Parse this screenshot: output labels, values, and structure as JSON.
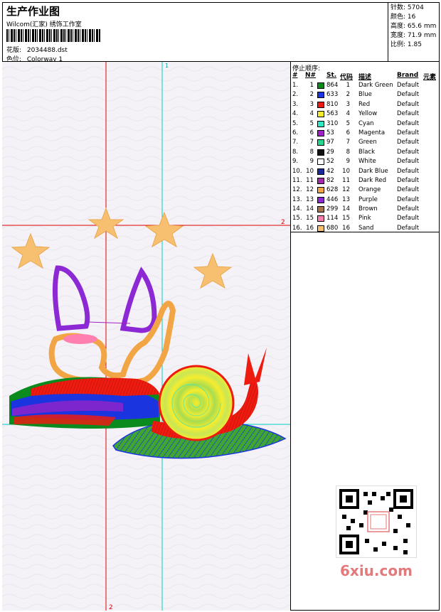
{
  "header": {
    "title": "生产作业图",
    "studio": "Wilcom(汇家) 绣饰工作室",
    "design_label": "花版:",
    "design_value": "2034488.dst",
    "colorway_label": "色位:",
    "colorway_value": "Colorway 1"
  },
  "stats": {
    "stitches_label": "针数:",
    "stitches_value": "5704",
    "colors_label": "颜色:",
    "colors_value": "16",
    "height_label": "高度:",
    "height_value": "65.6 mm",
    "width_label": "宽度:",
    "width_value": "71.9 mm",
    "ratio_label": "比例:",
    "ratio_value": "1.85"
  },
  "stop_sequence": {
    "title": "停止顺序:",
    "headers": {
      "idx": "#",
      "num": "N#",
      "st": "St.",
      "code": "代码",
      "desc": "描述",
      "brand": "Brand",
      "element": "元素"
    },
    "rows": [
      {
        "idx": "1.",
        "num": "1",
        "color": "#0b8a1e",
        "st": "864",
        "code": "1",
        "desc": "Dark Green",
        "brand": "Default"
      },
      {
        "idx": "2.",
        "num": "2",
        "color": "#1a35e0",
        "st": "633",
        "code": "2",
        "desc": "Blue",
        "brand": "Default"
      },
      {
        "idx": "3.",
        "num": "3",
        "color": "#ee1b10",
        "st": "810",
        "code": "3",
        "desc": "Red",
        "brand": "Default"
      },
      {
        "idx": "4.",
        "num": "4",
        "color": "#f6ec2e",
        "st": "563",
        "code": "4",
        "desc": "Yellow",
        "brand": "Default"
      },
      {
        "idx": "5.",
        "num": "5",
        "color": "#2fe8c6",
        "st": "310",
        "code": "5",
        "desc": "Cyan",
        "brand": "Default"
      },
      {
        "idx": "6.",
        "num": "6",
        "color": "#a021c7",
        "st": "53",
        "code": "6",
        "desc": "Magenta",
        "brand": "Default"
      },
      {
        "idx": "7.",
        "num": "7",
        "color": "#22d890",
        "st": "97",
        "code": "7",
        "desc": "Green",
        "brand": "Default"
      },
      {
        "idx": "8.",
        "num": "8",
        "color": "#111111",
        "st": "29",
        "code": "8",
        "desc": "Black",
        "brand": "Default"
      },
      {
        "idx": "9.",
        "num": "9",
        "color": "#ffffff",
        "st": "52",
        "code": "9",
        "desc": "White",
        "brand": "Default"
      },
      {
        "idx": "10.",
        "num": "10",
        "color": "#1b2a99",
        "st": "42",
        "code": "10",
        "desc": "Dark Blue",
        "brand": "Default"
      },
      {
        "idx": "11.",
        "num": "11",
        "color": "#a12aa8",
        "st": "82",
        "code": "11",
        "desc": "Dark Red",
        "brand": "Default"
      },
      {
        "idx": "12.",
        "num": "12",
        "color": "#f2a545",
        "st": "628",
        "code": "12",
        "desc": "Orange",
        "brand": "Default"
      },
      {
        "idx": "13.",
        "num": "13",
        "color": "#8d28d5",
        "st": "446",
        "code": "13",
        "desc": "Purple",
        "brand": "Default"
      },
      {
        "idx": "14.",
        "num": "14",
        "color": "#a8744a",
        "st": "299",
        "code": "14",
        "desc": "Brown",
        "brand": "Default"
      },
      {
        "idx": "15.",
        "num": "15",
        "color": "#ff7fb0",
        "st": "114",
        "code": "15",
        "desc": "Pink",
        "brand": "Default"
      },
      {
        "idx": "16.",
        "num": "16",
        "color": "#f7c070",
        "st": "680",
        "code": "16",
        "desc": "Sand",
        "brand": "Default"
      }
    ]
  },
  "guides": {
    "v1_top": "1",
    "h2_right": "2",
    "v2_bottom": "2"
  },
  "watermark": "6xiu.com",
  "colors": {
    "guide_red": "#e00000",
    "guide_cyan": "#00d0c0",
    "canvas_bg": "#f4f2f7"
  }
}
